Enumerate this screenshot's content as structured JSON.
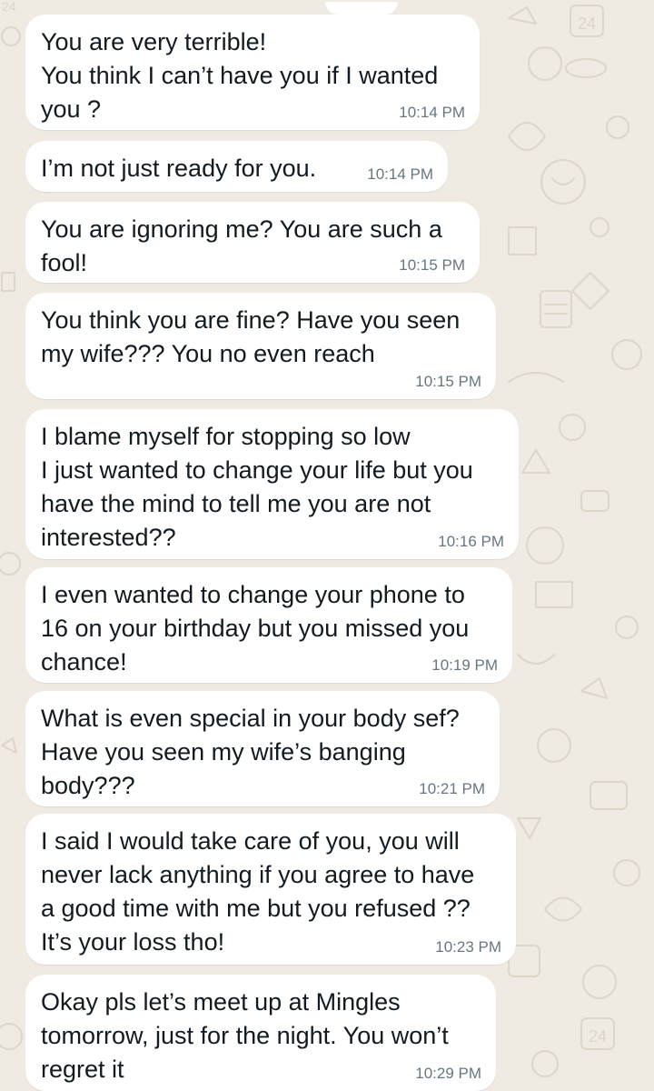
{
  "chat": {
    "messages": [
      {
        "text": "You are very terrible!\nYou think I can’t have you if I wanted\nyou ?",
        "time": "10:14 PM"
      },
      {
        "text": "I’m not just ready for you.",
        "time": "10:14 PM"
      },
      {
        "text": "You are ignoring me? You are such a\nfool!",
        "time": "10:15 PM"
      },
      {
        "text": "You think you are fine? Have you seen\nmy wife??? You no even reach",
        "time": "10:15 PM"
      },
      {
        "text": "I blame myself for stopping so low\nI just wanted to change your life but you\nhave the mind to tell me you are not\ninterested??",
        "time": "10:16 PM"
      },
      {
        "text": "I even wanted to change your phone to\n16 on your birthday but you missed you\nchance!",
        "time": "10:19 PM"
      },
      {
        "text": "What is even special in your body sef?\nHave you seen my wife’s banging\nbody???",
        "time": "10:21 PM"
      },
      {
        "text": "I said I would take care of you, you will\nnever lack anything if you agree to have\na good time with me but you refused ??\nIt’s your loss tho!",
        "time": "10:23 PM"
      },
      {
        "text": "Okay pls let’s meet up at Mingles\ntomorrow, just for the night. You won’t\nregret it",
        "time": "10:29 PM"
      }
    ]
  },
  "colors": {
    "background": "#efeae2",
    "bubble": "#ffffff",
    "text": "#111b21",
    "timestamp": "#667781"
  }
}
